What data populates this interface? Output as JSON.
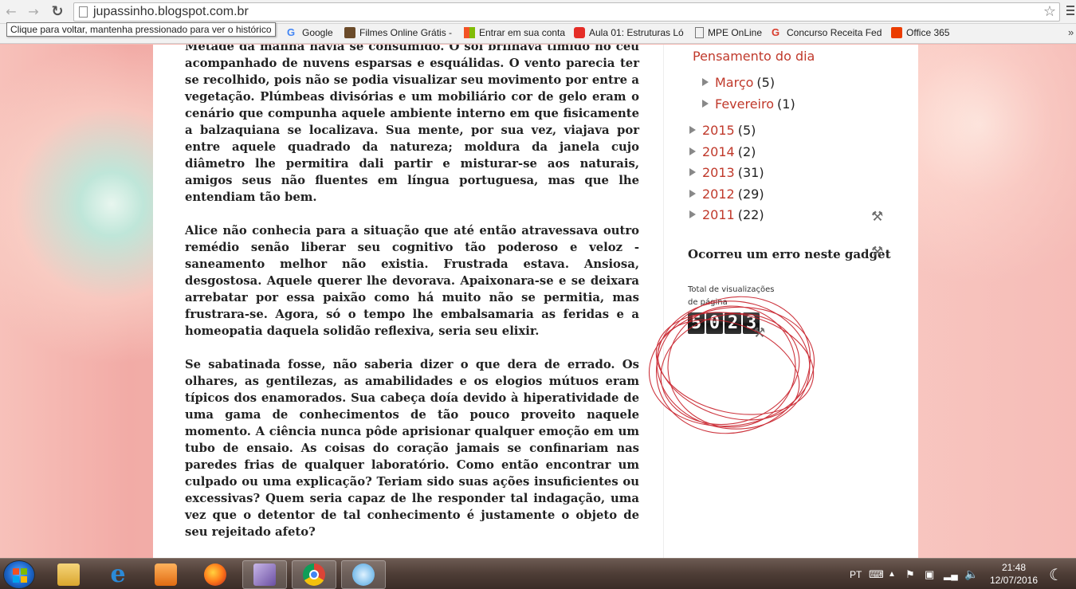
{
  "browser": {
    "url": "jupassinho.blogspot.com.br",
    "tooltip": "Clique para voltar, mantenha pressionado para ver o histórico",
    "bookmarks": [
      {
        "label": "Google",
        "icon": "google-icon"
      },
      {
        "label": "Filmes Online Grátis -",
        "icon": "film-icon"
      },
      {
        "label": "Entrar em sua conta",
        "icon": "windows-icon"
      },
      {
        "label": "Aula 01: Estruturas Ló",
        "icon": "youtube-icon"
      },
      {
        "label": "MPE OnLine",
        "icon": "page-icon"
      },
      {
        "label": "Concurso Receita Fed",
        "icon": "g-icon"
      },
      {
        "label": "Office 365",
        "icon": "office-icon"
      }
    ],
    "more_bookmarks": "»"
  },
  "post": {
    "paragraphs": [
      "Metade da manhã havia se consumido. O sol brilhava tímido no céu acompanhado de nuvens esparsas e esquálidas. O vento parecia ter se recolhido, pois não se podia visualizar seu movimento por entre a vegetação. Plúmbeas divisórias e um mobiliário cor de gelo eram o cenário que compunha aquele ambiente interno em que fisicamente a balzaquiana se localizava. Sua mente, por sua vez, viajava por entre aquele quadrado da natureza; moldura da janela cujo diâmetro lhe permitira dali partir e misturar-se aos naturais, amigos seus não fluentes em língua portuguesa, mas que lhe entendiam tão bem.",
      "Alice não conhecia para a situação que até então atravessava outro remédio senão liberar seu cognitivo tão poderoso e veloz - saneamento melhor não existia. Frustrada estava. Ansiosa, desgostosa. Aquele querer lhe devorava. Apaixonara-se e se deixara arrebatar por essa paixão como há muito não se permitia, mas frustrara-se. Agora, só o tempo lhe embalsamaria as feridas e a homeopatia daquela solidão reflexiva, seria seu elixir.",
      "Se sabatinada fosse, não saberia dizer o que dera de errado. Os olhares, as gentilezas, as amabilidades e os elogios mútuos eram típicos dos enamorados. Sua cabeça doía devido à hiperatividade de uma gama de conhecimentos de tão pouco proveito naquele momento. A ciência nunca pôde aprisionar qualquer emoção em um tubo de ensaio. As coisas do coração jamais se confinariam nas paredes frias de qualquer laboratório. Como então encontrar um culpado ou uma explicação? Teriam sido suas ações insuficientes ou excessivas? Quem seria capaz de lhe responder tal indagação, uma vez que o detentor de tal conhecimento é justamente o objeto de seu rejeitado afeto?"
    ]
  },
  "sidebar": {
    "heading": "Pensamento do dia",
    "months": [
      {
        "label": "Março",
        "count": "(5)"
      },
      {
        "label": "Fevereiro",
        "count": "(1)"
      }
    ],
    "years": [
      {
        "label": "2015",
        "count": "(5)"
      },
      {
        "label": "2014",
        "count": "(2)"
      },
      {
        "label": "2013",
        "count": "(31)"
      },
      {
        "label": "2012",
        "count": "(29)"
      },
      {
        "label": "2011",
        "count": "(22)"
      }
    ],
    "gadget_error": "Ocorreu um erro neste gadget",
    "pageviews": {
      "label": "Total de visualizações de página",
      "digits": [
        "5",
        "0",
        "2",
        "3"
      ]
    }
  },
  "taskbar": {
    "language": "PT",
    "time": "21:48",
    "date": "12/07/2016",
    "accent": "#c0392b"
  }
}
